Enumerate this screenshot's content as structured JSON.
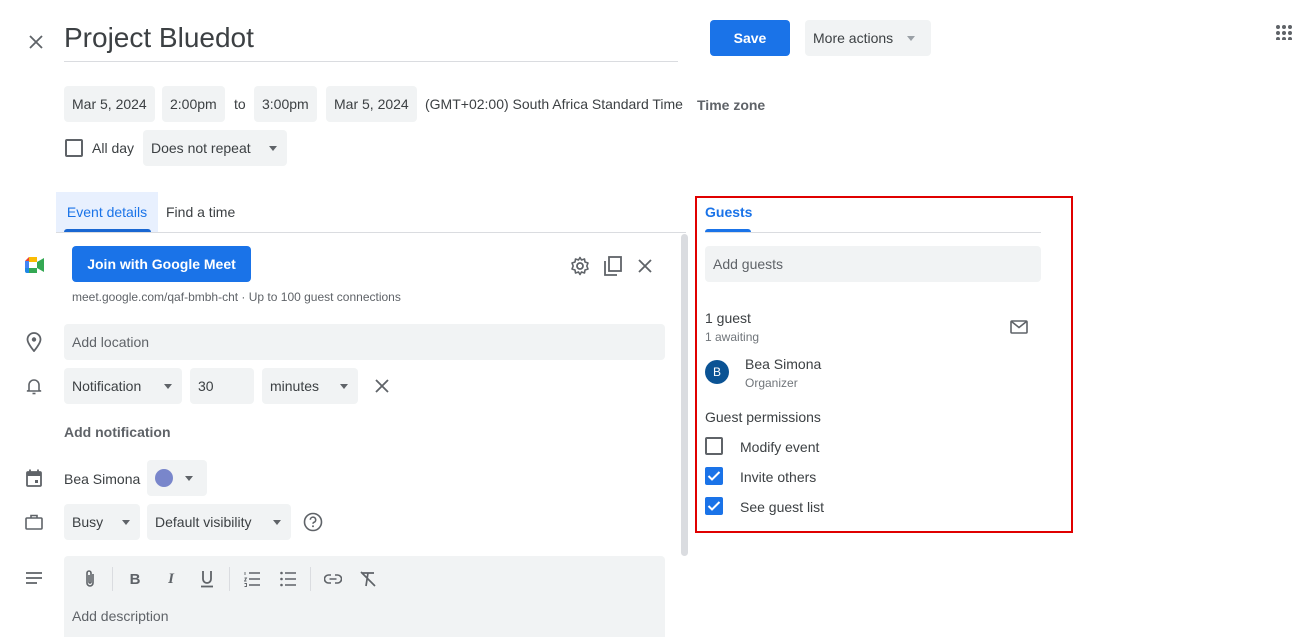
{
  "header": {
    "title": "Project Bluedot",
    "save_label": "Save",
    "more_actions_label": "More actions"
  },
  "datetime": {
    "start_date": "Mar 5, 2024",
    "start_time": "2:00pm",
    "to_label": "to",
    "end_time": "3:00pm",
    "end_date": "Mar 5, 2024",
    "timezone_text": "(GMT+02:00) South Africa Standard Time",
    "timezone_button": "Time zone",
    "all_day_label": "All day",
    "all_day_checked": false,
    "repeat": "Does not repeat"
  },
  "tabs": [
    {
      "label": "Event details",
      "active": true
    },
    {
      "label": "Find a time",
      "active": false
    }
  ],
  "meet": {
    "join_label": "Join with Google Meet",
    "link_text": "meet.google.com/qaf-bmbh-cht · Up to 100 guest connections"
  },
  "location": {
    "placeholder": "Add location"
  },
  "notification": {
    "type": "Notification",
    "amount": "30",
    "unit": "minutes",
    "add_label": "Add notification"
  },
  "calendar": {
    "owner": "Bea Simona",
    "color": "#7986cb"
  },
  "availability": {
    "status": "Busy",
    "visibility": "Default visibility"
  },
  "description": {
    "placeholder": "Add description"
  },
  "guests": {
    "tab_label": "Guests",
    "add_placeholder": "Add guests",
    "count_label": "1 guest",
    "awaiting_label": "1 awaiting",
    "list": [
      {
        "initial": "B",
        "name": "Bea Simona",
        "role": "Organizer",
        "avatar_color": "#0b5394"
      }
    ],
    "permissions_title": "Guest permissions",
    "permissions": [
      {
        "label": "Modify event",
        "checked": false
      },
      {
        "label": "Invite others",
        "checked": true
      },
      {
        "label": "See guest list",
        "checked": true
      }
    ]
  },
  "colors": {
    "accent": "#1a73e8",
    "highlight_box": "#e00000"
  }
}
